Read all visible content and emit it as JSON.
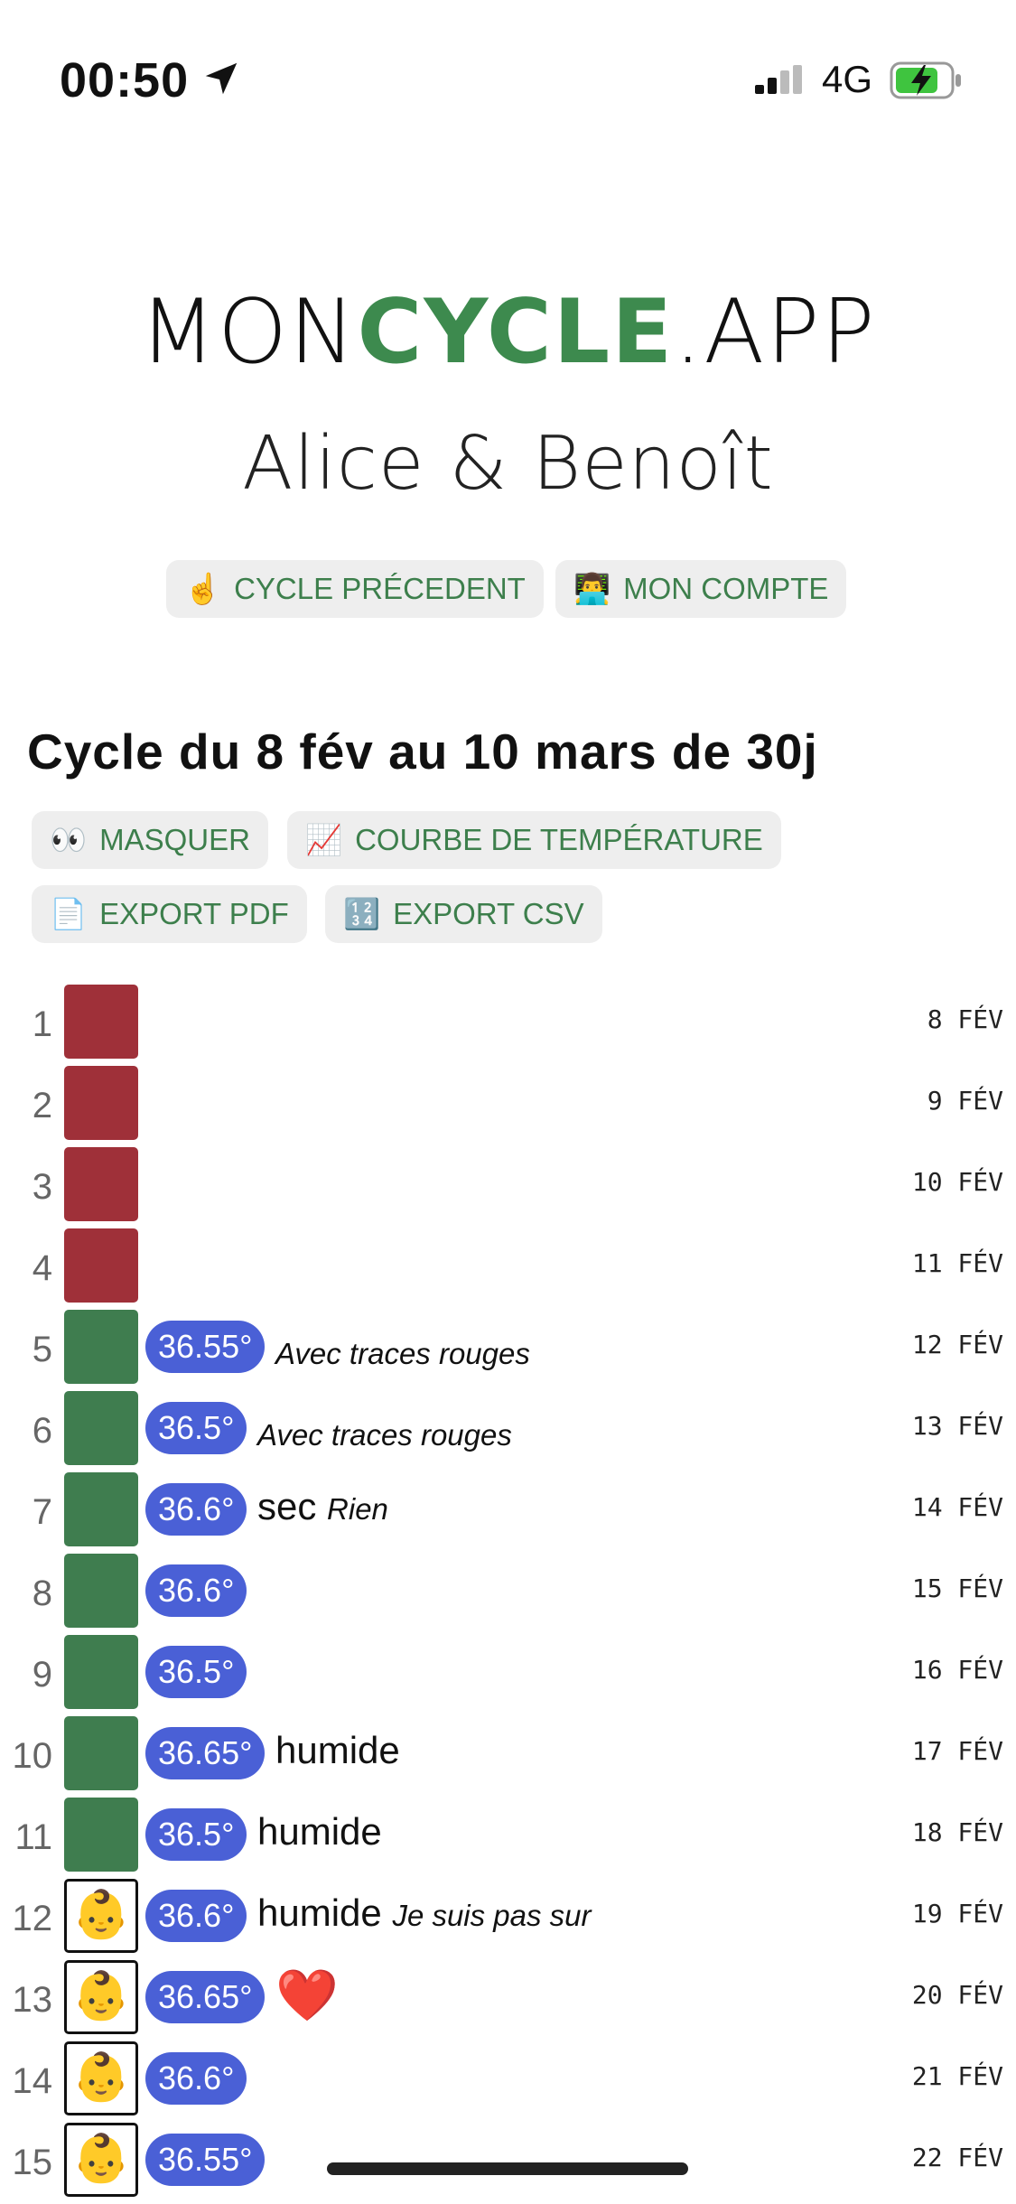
{
  "status_bar": {
    "time": "00:50",
    "network": "4G"
  },
  "logo": {
    "part1": "MON",
    "part2": "CYCLE",
    "part3": ".APP"
  },
  "couple": "Alice & Benoît",
  "top_buttons": [
    {
      "emoji": "☝️",
      "label": "CYCLE PRÉCEDENT"
    },
    {
      "emoji": "👨‍💻",
      "label": "MON COMPTE"
    }
  ],
  "cycle_title": "Cycle du 8 fév au 10 mars de 30j",
  "actions": [
    {
      "emoji": "👀",
      "label": "MASQUER"
    },
    {
      "emoji": "📈",
      "label": "COURBE DE TEMPÉRATURE"
    },
    {
      "emoji": "📄",
      "label": "EXPORT PDF"
    },
    {
      "emoji": "🔢",
      "label": "EXPORT CSV"
    }
  ],
  "days": [
    {
      "n": "1",
      "color": "red",
      "date": "8 FÉV"
    },
    {
      "n": "2",
      "color": "red",
      "date": "9 FÉV"
    },
    {
      "n": "3",
      "color": "red",
      "date": "10 FÉV"
    },
    {
      "n": "4",
      "color": "red",
      "date": "11 FÉV"
    },
    {
      "n": "5",
      "color": "green",
      "temp": "36.55°",
      "note": "Avec traces rouges",
      "date": "12 FÉV"
    },
    {
      "n": "6",
      "color": "green",
      "temp": "36.5°",
      "note": "Avec traces rouges",
      "date": "13 FÉV"
    },
    {
      "n": "7",
      "color": "green",
      "temp": "36.6°",
      "mucus": "sec",
      "note": "Rien",
      "date": "14 FÉV"
    },
    {
      "n": "8",
      "color": "green",
      "temp": "36.6°",
      "date": "15 FÉV"
    },
    {
      "n": "9",
      "color": "green",
      "temp": "36.5°",
      "date": "16 FÉV"
    },
    {
      "n": "10",
      "color": "green",
      "temp": "36.65°",
      "mucus": "humide",
      "date": "17 FÉV"
    },
    {
      "n": "11",
      "color": "green",
      "temp": "36.5°",
      "mucus": "humide",
      "date": "18 FÉV"
    },
    {
      "n": "12",
      "color": "baby",
      "emoji": "👶",
      "temp": "36.6°",
      "mucus": "humide",
      "note": "Je suis pas sur",
      "date": "19 FÉV"
    },
    {
      "n": "13",
      "color": "baby",
      "emoji": "👶",
      "temp": "36.65°",
      "heart": "❤️",
      "date": "20 FÉV"
    },
    {
      "n": "14",
      "color": "baby",
      "emoji": "👶",
      "temp": "36.6°",
      "date": "21 FÉV"
    },
    {
      "n": "15",
      "color": "baby",
      "emoji": "👶",
      "temp": "36.55°",
      "date": "22 FÉV"
    }
  ],
  "colors": {
    "period": "#9f3039",
    "green_day": "#3f7d4f",
    "temp_badge": "#4a60d6",
    "brand_green": "#3d8a4e"
  }
}
